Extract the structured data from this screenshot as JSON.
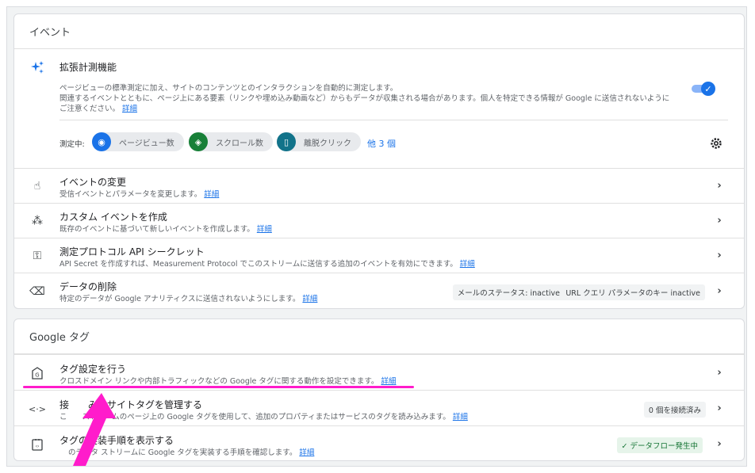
{
  "events_section": {
    "header": "イベント",
    "enhanced": {
      "title": "拡張計測機能",
      "desc_line1": "ページビューの標準測定に加え、サイトのコンテンツとのインタラクションを自動的に測定します。",
      "desc_line2": "関連するイベントとともに、ページ上にある要素（リンクや埋め込み動画など）からもデータが収集される場合があります。個人を特定できる情報が Google に送信されないように",
      "desc_line3": "ご注意ください。",
      "link": "詳細",
      "measuring_label": "測定中:",
      "chips": [
        {
          "label": "ページビュー数",
          "icon": "eye-icon",
          "color": "#1a73e8"
        },
        {
          "label": "スクロール数",
          "icon": "scroll-icon",
          "color": "#188038"
        },
        {
          "label": "離脱クリック",
          "icon": "mouse-icon",
          "color": "#12738a"
        }
      ],
      "more_link": "他 3 個",
      "toggle_on": true
    },
    "rows": [
      {
        "title": "イベントの変更",
        "desc": "受信イベントとパラメータを変更します。",
        "link": "詳細"
      },
      {
        "title": "カスタム イベントを作成",
        "desc": "既存のイベントに基づいて新しいイベントを作成します。",
        "link": "詳細"
      },
      {
        "title": "測定プロトコル API シークレット",
        "desc": "API Secret を作成すれば、Measurement Protocol でこのストリームに送信する追加のイベントを有効にできます。",
        "link": "詳細"
      },
      {
        "title": "データの削除",
        "desc": "特定のデータが Google アナリティクスに送信されないようにします。",
        "link": "詳細",
        "meta1": "メールのステータス: inactive",
        "meta2": "URL クエリ パラメータのキー inactive"
      }
    ]
  },
  "google_section": {
    "header": "Google タグ",
    "rows": [
      {
        "title": "タグ設定を行う",
        "desc": "クロスドメイン リンクや内部トラフィックなどの Google タグに関する動作を設定できます。",
        "link": "詳細"
      },
      {
        "title": "接続済みのサイトタグを管理する",
        "title_visible": "接　　みのサイトタグを管理する",
        "desc": "このストリームのページ上の Google タグを使用して、追加のプロパティまたはサービスのタグを読み込みます。",
        "desc_visible": "こ　　ストリームのページ上の Google タグを使用して、追加のプロパティまたはサービスのタグを読み込みます。",
        "link": "詳細",
        "meta": "0 個を接続済み"
      },
      {
        "title": "タグの実装手順を表示する",
        "title_visible": "タグの実装手順を表示する",
        "desc": "このデータ ストリームに Google タグを実装する手順を確認します。",
        "desc_visible": "のデータ ストリームに Google タグを実装する手順を確認します。",
        "link": "詳細",
        "badge": "✓ データフロー発生中"
      }
    ]
  },
  "colors": {
    "accent": "#1a73e8",
    "annotation": "#ff1ccb",
    "success": "#137333"
  }
}
